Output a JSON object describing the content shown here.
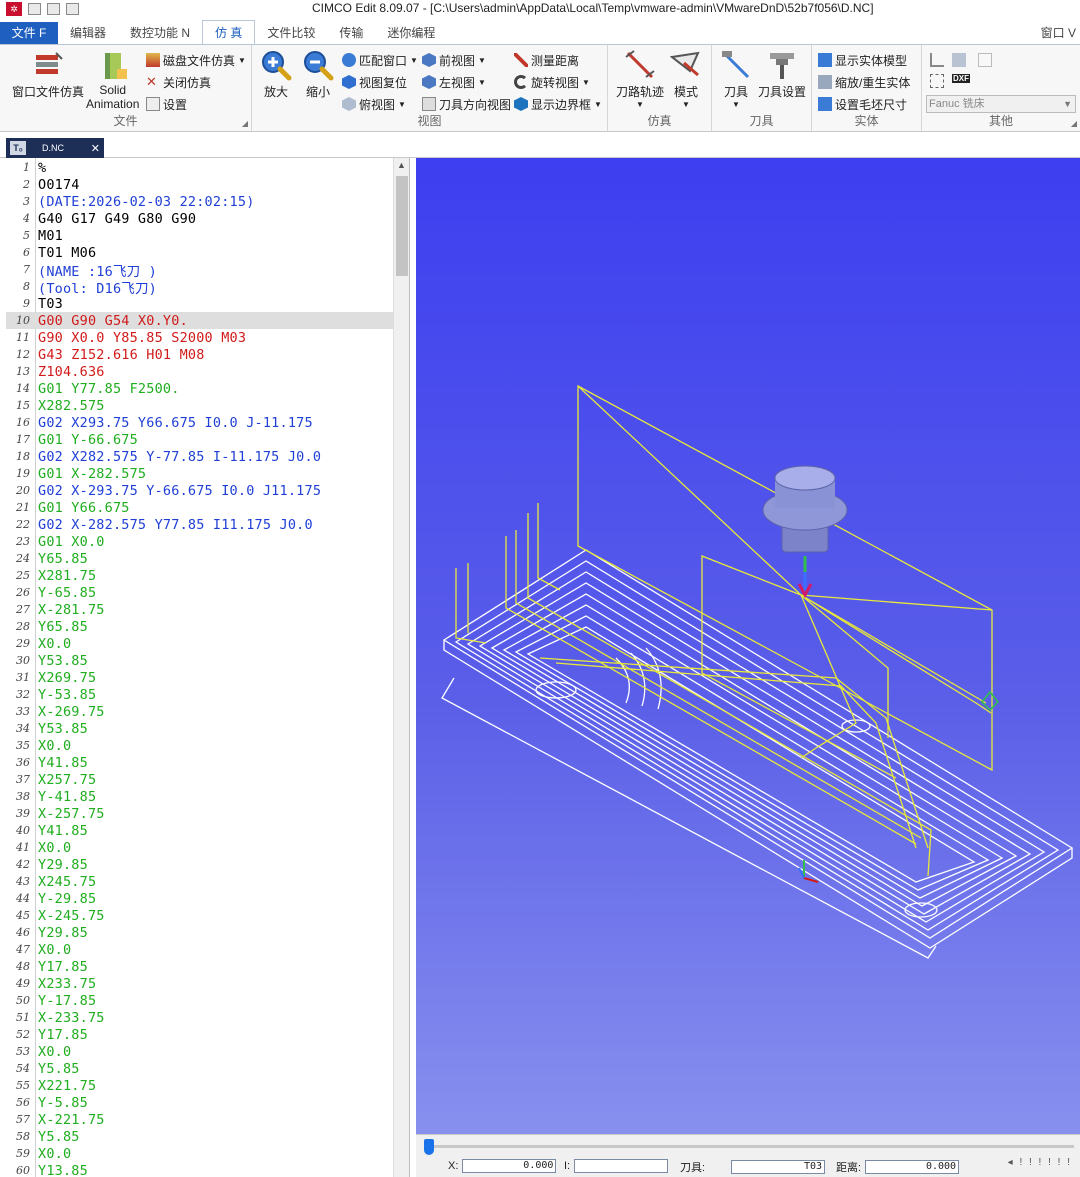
{
  "window": {
    "title": "CIMCO Edit 8.09.07 - [C:\\Users\\admin\\AppData\\Local\\Temp\\vmware-admin\\VMwareDnD\\52b7f056\\D.NC]"
  },
  "quick_access": {
    "logo": "✲"
  },
  "tabs": [
    {
      "label": "文件 F",
      "kind": "file"
    },
    {
      "label": "编辑器",
      "kind": ""
    },
    {
      "label": "数控功能 N",
      "kind": ""
    },
    {
      "label": "仿 真",
      "kind": "active"
    },
    {
      "label": "文件比较",
      "kind": ""
    },
    {
      "label": "传输",
      "kind": ""
    },
    {
      "label": "迷你编程",
      "kind": ""
    }
  ],
  "tab_right": "窗口 V",
  "ribbon": {
    "file_group": {
      "label": "文件",
      "open_sim": "窗口文件仿真",
      "solid_animation_1": "Solid",
      "solid_animation_2": "Animation",
      "disk_sim": "磁盘文件仿真",
      "close_sim": "关闭仿真",
      "settings": "设置"
    },
    "view_group": {
      "label": "视图",
      "zoom_in": "放大",
      "zoom_out": "缩小",
      "fit_window": "匹配窗口",
      "view_reset": "视图复位",
      "top_view": "俯视图",
      "front_view": "前视图",
      "left_view": "左视图",
      "tool_dir_view": "刀具方向视图",
      "measure": "测量距离",
      "rotate_view": "旋转视图",
      "show_bounds": "显示边界框"
    },
    "sim_group": {
      "label": "仿真",
      "toolpath": "刀路轨迹",
      "mode": "模式"
    },
    "tool_group": {
      "label": "刀具",
      "tool": "刀具",
      "tool_settings": "刀具设置"
    },
    "solid_group": {
      "label": "实体",
      "show_solid": "显示实体模型",
      "scale_regen": "缩放/重生实体",
      "stock_size": "设置毛坯尺寸"
    },
    "other_group": {
      "label": "其他",
      "machine_combo": "Fanuc 铣床",
      "dxf": "DXF"
    }
  },
  "document_tab": {
    "name": "D.NC",
    "close": "✕",
    "icon": "T₀"
  },
  "editor": {
    "highlight_line": 10,
    "lines": [
      {
        "n": 1,
        "t": "%",
        "c": "#000000"
      },
      {
        "n": 2,
        "t": "O0174",
        "c": "#000000"
      },
      {
        "n": 3,
        "t": "(DATE:2026-02-03 22:02:15)",
        "c": "#1f3fd6"
      },
      {
        "n": 4,
        "t": "G40 G17 G49 G80 G90",
        "c": "#000000"
      },
      {
        "n": 5,
        "t": "M01",
        "c": "#000000"
      },
      {
        "n": 6,
        "t": "T01 M06",
        "c": "#000000"
      },
      {
        "n": 7,
        "t": "(NAME :16飞刀 )",
        "c": "#1f3fd6"
      },
      {
        "n": 8,
        "t": "(Tool: D16飞刀)",
        "c": "#1f3fd6"
      },
      {
        "n": 9,
        "t": "T03",
        "c": "#000000"
      },
      {
        "n": 10,
        "t": "G00 G90 G54 X0.Y0.",
        "c": "#d11a1a"
      },
      {
        "n": 11,
        "t": "G90 X0.0 Y85.85 S2000 M03",
        "c": "#d11a1a"
      },
      {
        "n": 12,
        "t": "G43 Z152.616 H01 M08",
        "c": "#d11a1a"
      },
      {
        "n": 13,
        "t": "Z104.636",
        "c": "#d11a1a"
      },
      {
        "n": 14,
        "t": "G01 Y77.85 F2500.",
        "c": "#1fae1f"
      },
      {
        "n": 15,
        "t": "X282.575",
        "c": "#1fae1f"
      },
      {
        "n": 16,
        "t": "G02 X293.75 Y66.675 I0.0 J-11.175",
        "c": "#1f3fd6"
      },
      {
        "n": 17,
        "t": "G01 Y-66.675",
        "c": "#1fae1f"
      },
      {
        "n": 18,
        "t": "G02 X282.575 Y-77.85 I-11.175 J0.0",
        "c": "#1f3fd6"
      },
      {
        "n": 19,
        "t": "G01 X-282.575",
        "c": "#1fae1f"
      },
      {
        "n": 20,
        "t": "G02 X-293.75 Y-66.675 I0.0 J11.175",
        "c": "#1f3fd6"
      },
      {
        "n": 21,
        "t": "G01 Y66.675",
        "c": "#1fae1f"
      },
      {
        "n": 22,
        "t": "G02 X-282.575 Y77.85 I11.175 J0.0",
        "c": "#1f3fd6"
      },
      {
        "n": 23,
        "t": "G01 X0.0",
        "c": "#1fae1f"
      },
      {
        "n": 24,
        "t": "Y65.85",
        "c": "#1fae1f"
      },
      {
        "n": 25,
        "t": "X281.75",
        "c": "#1fae1f"
      },
      {
        "n": 26,
        "t": "Y-65.85",
        "c": "#1fae1f"
      },
      {
        "n": 27,
        "t": "X-281.75",
        "c": "#1fae1f"
      },
      {
        "n": 28,
        "t": "Y65.85",
        "c": "#1fae1f"
      },
      {
        "n": 29,
        "t": "X0.0",
        "c": "#1fae1f"
      },
      {
        "n": 30,
        "t": "Y53.85",
        "c": "#1fae1f"
      },
      {
        "n": 31,
        "t": "X269.75",
        "c": "#1fae1f"
      },
      {
        "n": 32,
        "t": "Y-53.85",
        "c": "#1fae1f"
      },
      {
        "n": 33,
        "t": "X-269.75",
        "c": "#1fae1f"
      },
      {
        "n": 34,
        "t": "Y53.85",
        "c": "#1fae1f"
      },
      {
        "n": 35,
        "t": "X0.0",
        "c": "#1fae1f"
      },
      {
        "n": 36,
        "t": "Y41.85",
        "c": "#1fae1f"
      },
      {
        "n": 37,
        "t": "X257.75",
        "c": "#1fae1f"
      },
      {
        "n": 38,
        "t": "Y-41.85",
        "c": "#1fae1f"
      },
      {
        "n": 39,
        "t": "X-257.75",
        "c": "#1fae1f"
      },
      {
        "n": 40,
        "t": "Y41.85",
        "c": "#1fae1f"
      },
      {
        "n": 41,
        "t": "X0.0",
        "c": "#1fae1f"
      },
      {
        "n": 42,
        "t": "Y29.85",
        "c": "#1fae1f"
      },
      {
        "n": 43,
        "t": "X245.75",
        "c": "#1fae1f"
      },
      {
        "n": 44,
        "t": "Y-29.85",
        "c": "#1fae1f"
      },
      {
        "n": 45,
        "t": "X-245.75",
        "c": "#1fae1f"
      },
      {
        "n": 46,
        "t": "Y29.85",
        "c": "#1fae1f"
      },
      {
        "n": 47,
        "t": "X0.0",
        "c": "#1fae1f"
      },
      {
        "n": 48,
        "t": "Y17.85",
        "c": "#1fae1f"
      },
      {
        "n": 49,
        "t": "X233.75",
        "c": "#1fae1f"
      },
      {
        "n": 50,
        "t": "Y-17.85",
        "c": "#1fae1f"
      },
      {
        "n": 51,
        "t": "X-233.75",
        "c": "#1fae1f"
      },
      {
        "n": 52,
        "t": "Y17.85",
        "c": "#1fae1f"
      },
      {
        "n": 53,
        "t": "X0.0",
        "c": "#1fae1f"
      },
      {
        "n": 54,
        "t": "Y5.85",
        "c": "#1fae1f"
      },
      {
        "n": 55,
        "t": "X221.75",
        "c": "#1fae1f"
      },
      {
        "n": 56,
        "t": "Y-5.85",
        "c": "#1fae1f"
      },
      {
        "n": 57,
        "t": "X-221.75",
        "c": "#1fae1f"
      },
      {
        "n": 58,
        "t": "Y5.85",
        "c": "#1fae1f"
      },
      {
        "n": 59,
        "t": "X0.0",
        "c": "#1fae1f"
      },
      {
        "n": 60,
        "t": "Y13.85",
        "c": "#1fae1f"
      }
    ]
  },
  "status": {
    "x_label": "X:",
    "x_value": "0.000",
    "i_label": "I:",
    "i_value": "",
    "tool_label": "刀具:",
    "tool_value": "T03",
    "dist_label": "距离:",
    "dist_value": "0.000",
    "sim_progress": 0
  },
  "colors": {
    "accent": "#1e5fbf",
    "code_black": "#000000",
    "code_blue": "#1f3fd6",
    "code_red": "#d11a1a",
    "code_green": "#1fae1f",
    "toolpath_white": "#ffffff",
    "toolpath_yellow": "#e8e83a"
  }
}
